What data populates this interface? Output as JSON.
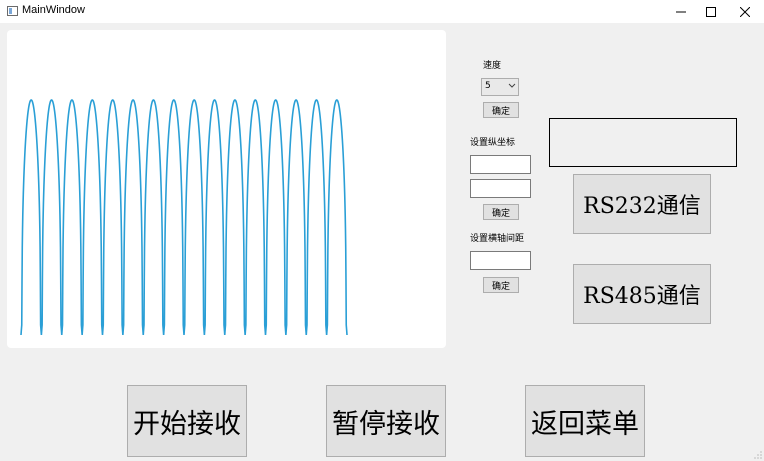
{
  "window": {
    "title": "MainWindow"
  },
  "controls": {
    "speed_label": "速度",
    "speed_value": "5",
    "speed_confirm": "确定",
    "y_axis_label": "设置纵坐标",
    "y_min_value": "",
    "y_max_value": "",
    "y_confirm": "确定",
    "x_spacing_label": "设置横轴间距",
    "x_spacing_value": "",
    "x_confirm": "确定"
  },
  "comm": {
    "display_text": "",
    "rs232_label": "RS232通信",
    "rs485_label": "RS485通信"
  },
  "actions": {
    "start_label": "开始接收",
    "pause_label": "暂停接收",
    "back_label": "返回菜单"
  },
  "colors": {
    "waveform": "#2a9fd6",
    "plot_bg": "#ffffff",
    "window_bg": "#f0f0f0"
  },
  "chart_data": {
    "type": "line",
    "title": "",
    "xlabel": "",
    "ylabel": "",
    "grid": false,
    "legend": "none",
    "ylim": [
      0,
      1
    ],
    "series": [
      {
        "peak_count": 16,
        "main_peak": 1.0,
        "sub_peak": 0.07
      }
    ]
  }
}
